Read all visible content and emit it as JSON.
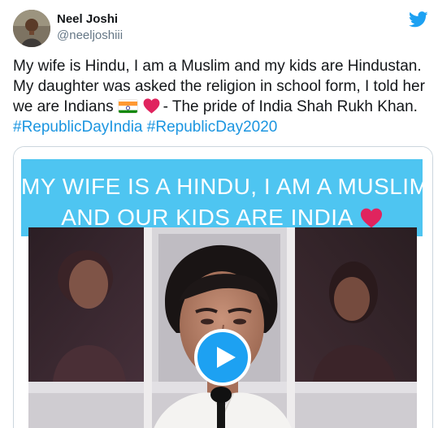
{
  "author": {
    "name": "Neel Joshi",
    "handle": "@neeljoshiii"
  },
  "icons": {
    "brand": "twitter-bird-icon",
    "play": "play-icon",
    "flag": "india-flag-icon",
    "heart": "red-heart-icon"
  },
  "tweet": {
    "line1": "My wife is Hindu, I am a Muslim and my kids are Hindustan.",
    "line2": "My daughter was asked the religion in school form, I told her",
    "line3_start": "we are Indians",
    "line3_end": "- The pride of India Shah Rukh Khan.",
    "hashtag1": "#RepublicDayIndia",
    "hashtag2": "#RepublicDay2020"
  },
  "media": {
    "banner_line1": "MY WIFE IS A HINDU, I AM A MUSLIM,",
    "banner_line2": "AND OUR KIDS ARE INDIA"
  },
  "colors": {
    "accent": "#1da1f2",
    "hashtag": "#1b95e0",
    "banner": "#4ec5f1",
    "handle": "#657786",
    "heart": "#e0245e"
  }
}
